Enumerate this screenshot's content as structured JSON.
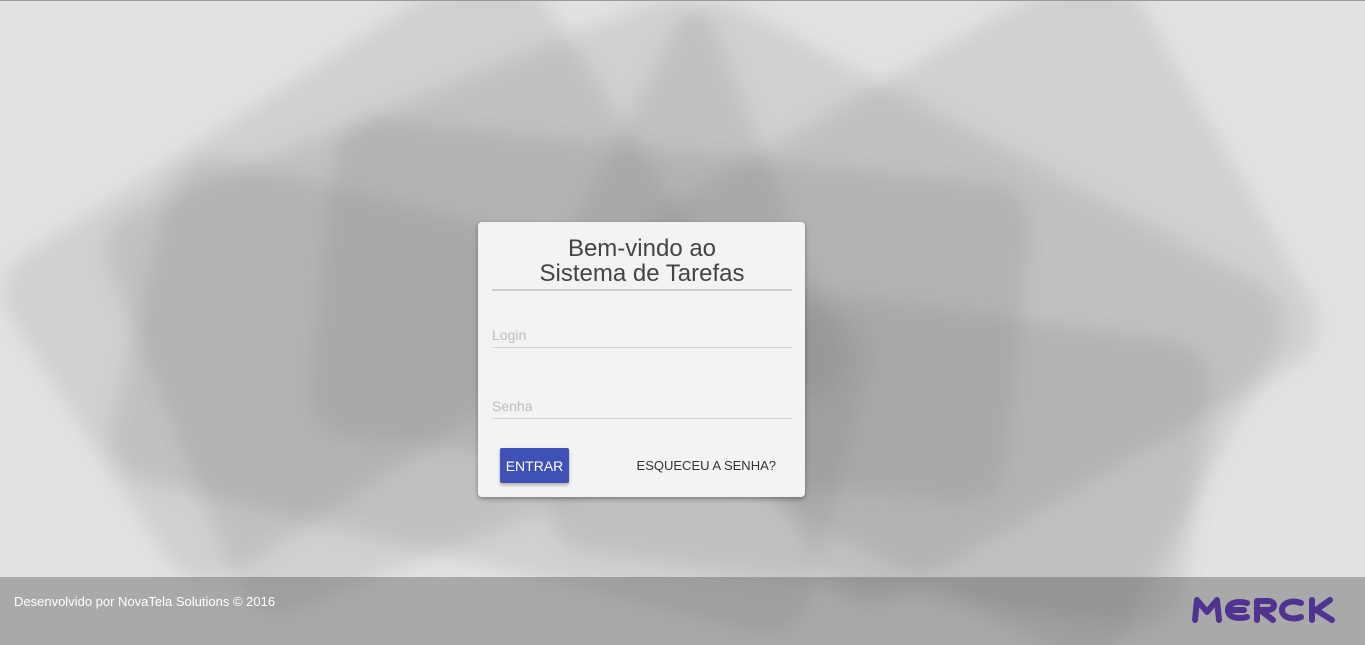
{
  "login_card": {
    "title_line1": "Bem-vindo ao",
    "title_line2": "Sistema de Tarefas",
    "login_placeholder": "Login",
    "password_placeholder": "Senha",
    "login_value": "",
    "password_value": "",
    "submit_label": "ENTRAR",
    "forgot_label": "ESQUECEU A SENHA?"
  },
  "footer": {
    "credit": "Desenvolvido por NovaTela Solutions © 2016",
    "logo_text": "MERCK"
  },
  "colors": {
    "accent": "#3f51b5",
    "logo": "#503291",
    "background": "#e2e2e2",
    "card": "#f3f3f3"
  },
  "icons": {
    "logo": "merck-wordmark-logo"
  }
}
